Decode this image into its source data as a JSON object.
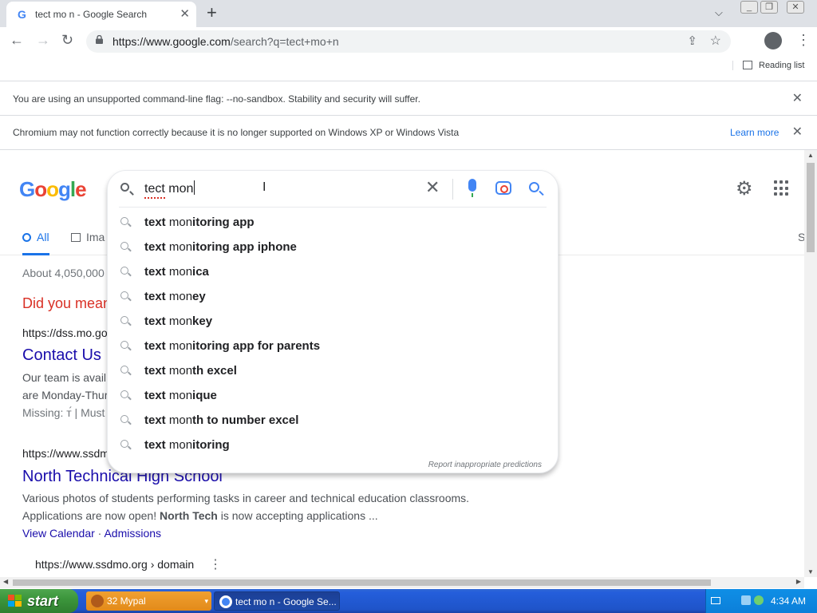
{
  "browser": {
    "tab_title": "tect mo n - Google Search",
    "url_host": "https://www.google.com",
    "url_rest": "/search?q=tect+mo+n",
    "reading_list": "Reading list"
  },
  "infobars": {
    "flag_warning": "You are using an unsupported command-line flag: --no-sandbox. Stability and security will suffer.",
    "os_warning": "Chromium may not function correctly because it is no longer supported on Windows XP or Windows Vista",
    "learn_more": "Learn more"
  },
  "google": {
    "logo_letters": [
      "G",
      "o",
      "o",
      "g",
      "l",
      "e"
    ],
    "logo_colors": [
      "#4285f4",
      "#ea4335",
      "#fbbc05",
      "#4285f4",
      "#34a853",
      "#ea4335"
    ]
  },
  "search": {
    "query": "tect mon",
    "tabs": {
      "all": "All",
      "images": "Ima",
      "more": "S"
    },
    "report_text": "Report inappropriate predictions",
    "suggestions": [
      {
        "a": "text",
        "b": " mon",
        "c": "itoring app"
      },
      {
        "a": "text",
        "b": " mon",
        "c": "itoring app iphone"
      },
      {
        "a": "text",
        "b": " mon",
        "c": "ica"
      },
      {
        "a": "text",
        "b": " mon",
        "c": "ey"
      },
      {
        "a": "text",
        "b": " mon",
        "c": "key"
      },
      {
        "a": "text",
        "b": " mon",
        "c": "itoring app for parents"
      },
      {
        "a": "text",
        "b": " mon",
        "c": "th excel"
      },
      {
        "a": "text",
        "b": " mon",
        "c": "ique"
      },
      {
        "a": "text",
        "b": " mon",
        "c": "th to number excel"
      },
      {
        "a": "text",
        "b": " mon",
        "c": "itoring"
      }
    ]
  },
  "results": {
    "stats": "About 4,050,000",
    "did_you_mean": "Did you mean",
    "r1_cite": "https://dss.mo.go",
    "r1_title": "Contact Us",
    "r1_snip1": "Our team is avail",
    "r1_snip2": "are Monday-Thur",
    "r1_snip3": "Missing: т́ | Must",
    "r2_cite": "https://www.ssdm",
    "r2_title": "North Technical High School",
    "r2_snip1": "Various photos of students performing tasks in career and technical education classrooms.",
    "r2_snip2_pre": "Applications are now open! ",
    "r2_snip2_bold": "North Tech",
    "r2_snip2_post": " is now accepting applications ...",
    "r2_link1": "View Calendar",
    "r2_sep": " · ",
    "r2_link2": "Admissions",
    "r3_cite": "https://www.ssdmo.org › domain"
  },
  "taskbar": {
    "start": "start",
    "task1": "32 Mypal",
    "task2": "tect mo n - Google Se...",
    "clock": "4:34 AM"
  }
}
